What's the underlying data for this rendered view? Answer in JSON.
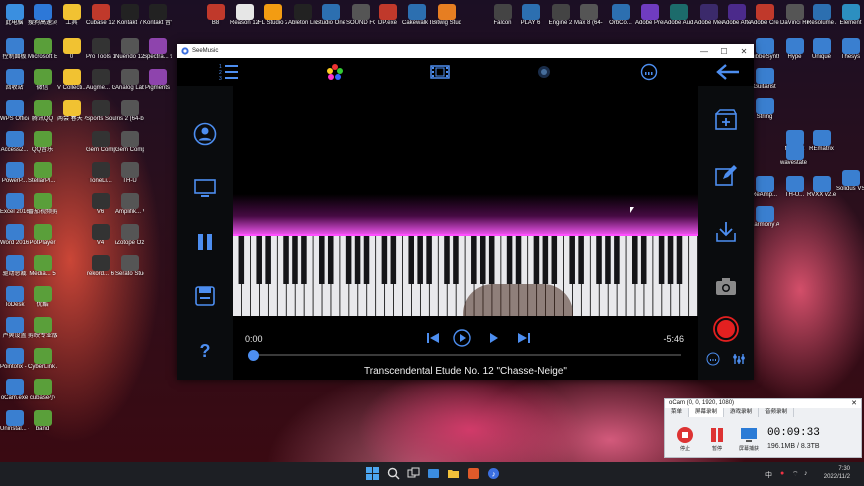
{
  "desktop": {
    "icons": [
      {
        "label": "此电脑",
        "color": "#3a8fe0"
      },
      {
        "label": "搜狗高速浏览器",
        "color": "#2d78d8"
      },
      {
        "label": "工具",
        "color": "#f1c232"
      },
      {
        "label": "Cubase 12",
        "color": "#c0392b"
      },
      {
        "label": "Kontakt 7",
        "color": "#222222"
      },
      {
        "label": "Kontakt 音色库名",
        "color": "#222222"
      },
      {
        "label": "B8",
        "color": "#c0392b"
      },
      {
        "label": "Reason 12",
        "color": "#e6e6e6"
      },
      {
        "label": "FL Studio 20",
        "color": "#f39c12"
      },
      {
        "label": "Ableton Live 11",
        "color": "#222222"
      },
      {
        "label": "Studio One 6",
        "color": "#2c6fb0"
      },
      {
        "label": "SOUND FORGE P...",
        "color": "#555555"
      },
      {
        "label": "DP.exe",
        "color": "#c0392b"
      },
      {
        "label": "Cakewalk by Ban...",
        "color": "#2c6fb0"
      },
      {
        "label": "Bitwig Studio.e...",
        "color": "#e67e22"
      },
      {
        "label": "Falcon",
        "color": "#444444"
      },
      {
        "label": "PLAY 6",
        "color": "#2c6fb0"
      },
      {
        "label": "Engine 2",
        "color": "#444444"
      },
      {
        "label": "Max 8 (64-bit)",
        "color": "#555555"
      },
      {
        "label": "OrbCo...",
        "color": "#2c6fb0"
      },
      {
        "label": "Adobe Premie...",
        "color": "#6f3cc0"
      },
      {
        "label": "Adobe Auditi...",
        "color": "#1c6b6b"
      },
      {
        "label": "Adobe Media...",
        "color": "#3b2a6b"
      },
      {
        "label": "Adobe After...",
        "color": "#4b2a8b"
      },
      {
        "label": "Adobe Creati...",
        "color": "#c0392b"
      },
      {
        "label": "DaVinci Resolve",
        "color": "#555555"
      },
      {
        "label": "Resolume Arena",
        "color": "#2c6fb0"
      },
      {
        "label": "Element",
        "color": "#2c8fc0"
      }
    ],
    "left_icons": [
      "控制面板",
      "回收站",
      "WPS Office",
      "Access2...",
      "PowerP...",
      "Excel 2016",
      "Word 2016",
      "驱动总裁",
      "ToDesk",
      "芦爽设置",
      "Pointofix - 快捷方式",
      "oCam.exe",
      "Uninstal... - 快捷方式"
    ],
    "col2_icons": [
      "Microsoft Edge",
      "微信",
      "腾讯QQ",
      "QQ音乐",
      "StellarPl... - 快捷方式",
      "番茄视频剪辑",
      "PotPlayer",
      "Media... 5",
      "优酷",
      "剪映专业版",
      "CyberLink AudioDi...",
      "cubase小",
      "band"
    ],
    "col3_icons": [
      "0",
      "V Collecti...",
      "两会 春天 小特 @版",
      "",
      "",
      "",
      "",
      "",
      "",
      "",
      "",
      "",
      ""
    ],
    "col4_icons": [
      "Pro Tools 12",
      "Augme... GRAND...",
      "Sports Sounds ...",
      "Gem Comp LA",
      "ToneLi...",
      "V6",
      "V4",
      "rekord... 6"
    ],
    "col5_icons": [
      "Nuendo 12",
      "Analog Lab V",
      "Iris 2 (64-bit)",
      "Gem Comp76",
      "TH-U",
      "Amplifik... VVV",
      "iZotope Ozone 9",
      "Serato Studio"
    ],
    "col6_icons": [
      "Spectra... 9",
      "Pigments",
      "",
      "",
      "",
      "",
      "",
      ""
    ],
    "right_icons": [
      "RibbeSynth",
      "Hype",
      "Unique",
      "Thesys",
      "Guitarist",
      "String",
      "MixBox",
      "wavestate native",
      "REmatrix",
      "ReAmp...",
      "TH-U...",
      "RVXX v2.exe",
      "Solidus VS8100",
      "Harmony Assista..."
    ]
  },
  "app": {
    "window_title": "SeeMusic",
    "window_controls": {
      "minimize": "—",
      "maximize": "☐",
      "close": "✕"
    },
    "time_current": "0:00",
    "time_remaining": "-5:46",
    "song_title": "Transcendental Etude No. 12 \"Chasse-Neige\"",
    "progress_fraction": 0.0,
    "accent_color": "#4d8ef0",
    "glow_color": "#ff4dff",
    "record_color": "#e32020"
  },
  "taskbar": {
    "tray_text": "中",
    "clock_time": "7:30",
    "clock_date": "2022/11/2"
  },
  "ocam": {
    "title": "oCam (0, 0, 1920, 1080)",
    "close": "✕",
    "tabs": [
      "菜单",
      "屏幕录制",
      "游戏录制",
      "音频录制"
    ],
    "buttons": [
      "停止",
      "暂停",
      "屏幕捕获"
    ],
    "elapsed": "00:09:33",
    "size": "196.1MB / 8.3TB"
  }
}
